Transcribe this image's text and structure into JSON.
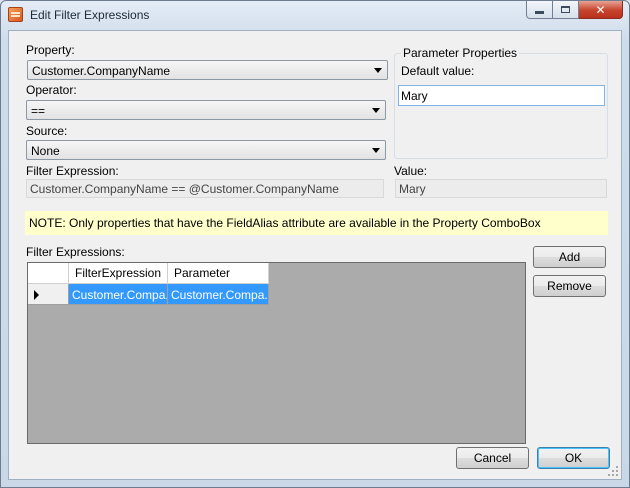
{
  "window": {
    "title": "Edit Filter Expressions",
    "icon": "app-icon"
  },
  "form": {
    "property_label": "Property:",
    "property_value": "Customer.CompanyName",
    "operator_label": "Operator:",
    "operator_value": "==",
    "source_label": "Source:",
    "source_value": "None",
    "filter_expression_label": "Filter Expression:",
    "filter_expression_value": "Customer.CompanyName == @Customer.CompanyName",
    "value_label": "Value:",
    "value_value": "Mary"
  },
  "parameter_properties": {
    "title": "Parameter Properties",
    "default_value_label": "Default value:",
    "default_value": "Mary"
  },
  "note": "NOTE: Only properties that have the FieldAlias attribute are available in the Property ComboBox",
  "filter_expressions": {
    "label": "Filter Expressions:",
    "columns": [
      "FilterExpression",
      "Parameter"
    ],
    "rows": [
      {
        "filter_expression": "Customer.Compa...",
        "parameter": "Customer.Compa..."
      }
    ]
  },
  "buttons": {
    "add": "Add",
    "remove": "Remove",
    "cancel": "Cancel",
    "ok": "OK"
  },
  "colors": {
    "selection": "#3399ff",
    "note_background": "#ffffcc",
    "grid_background": "#ababab"
  }
}
